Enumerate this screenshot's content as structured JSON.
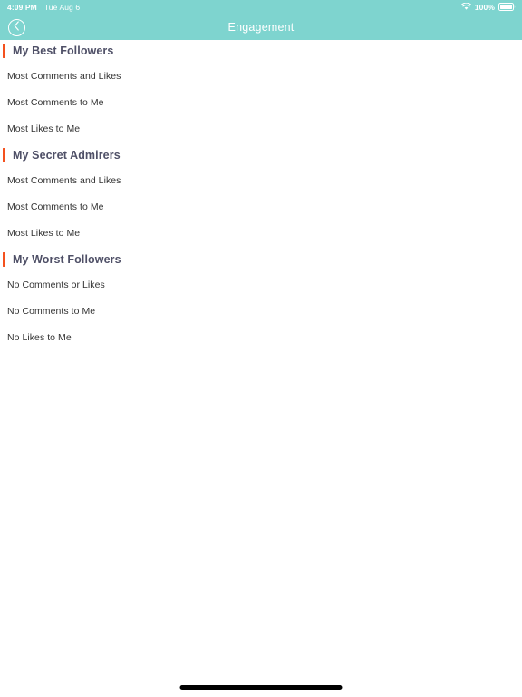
{
  "status_bar": {
    "time": "4:09 PM",
    "date": "Tue Aug 6",
    "wifi_icon": "wifi-icon",
    "battery_percent": "100%",
    "battery_icon": "battery-full-icon"
  },
  "nav_bar": {
    "back_icon": "chevron-left-circle-icon",
    "title": "Engagement"
  },
  "theme": {
    "header_teal": "#7ed4cf",
    "accent_orange": "#f4511e",
    "heading_color": "#4f5067",
    "item_color": "#333333",
    "background": "#ffffff"
  },
  "sections": [
    {
      "title": "My Best Followers",
      "items": [
        "Most Comments and Likes",
        "Most Comments to Me",
        "Most Likes to Me"
      ]
    },
    {
      "title": "My Secret Admirers",
      "items": [
        "Most Comments and Likes",
        "Most Comments to Me",
        "Most Likes to Me"
      ]
    },
    {
      "title": "My Worst Followers",
      "items": [
        "No Comments or Likes",
        "No Comments to Me",
        "No Likes to Me"
      ]
    }
  ],
  "home_indicator": "home-indicator"
}
